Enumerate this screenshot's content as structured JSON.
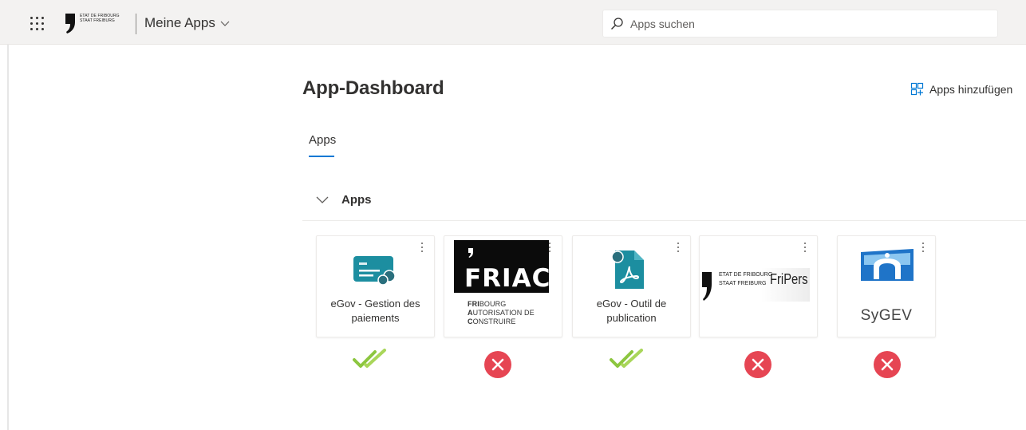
{
  "header": {
    "brand_line1": "ETAT DE FRIBOURG",
    "brand_line2": "STAAT FREIBURG",
    "app_switcher_label": "Meine Apps",
    "search_placeholder": "Apps suchen"
  },
  "page": {
    "title": "App-Dashboard",
    "add_apps_label": "Apps hinzufügen",
    "tab_label": "Apps",
    "section_label": "Apps"
  },
  "apps": [
    {
      "name": "eGov - Gestion des paiements",
      "line1": "eGov - Gestion des",
      "line2": "paiements",
      "status": "ok"
    },
    {
      "name": "FRIAC",
      "logo_text": "FRIAC",
      "sub1_bold": "FRI",
      "sub1": "BOURG",
      "sub2_bold": "A",
      "sub2": "UTORISATION DE",
      "sub3_bold": "C",
      "sub3": "ONSTRUIRE",
      "status": "error"
    },
    {
      "name": "eGov - Outil de publication",
      "line1": "eGov - Outil de",
      "line2": "publication",
      "status": "ok"
    },
    {
      "name": "FriPers",
      "logo_line1": "ETAT DE FRIBOURG",
      "logo_line2": "STAAT FREIBURG",
      "logo_text": "FriPers",
      "status": "error"
    },
    {
      "name": "SyGEV",
      "logo_text": "SyGEV",
      "status": "error"
    }
  ],
  "colors": {
    "accent": "#0078d4",
    "ok": "#8cc63f",
    "error": "#e64553",
    "card_icon_teal": "#1c8ea0"
  },
  "icons": {
    "app_launcher": "waffle-icon",
    "search": "search-icon",
    "add_apps": "grid-add-icon",
    "status_ok": "double-check-icon",
    "status_error": "error-x-icon"
  }
}
